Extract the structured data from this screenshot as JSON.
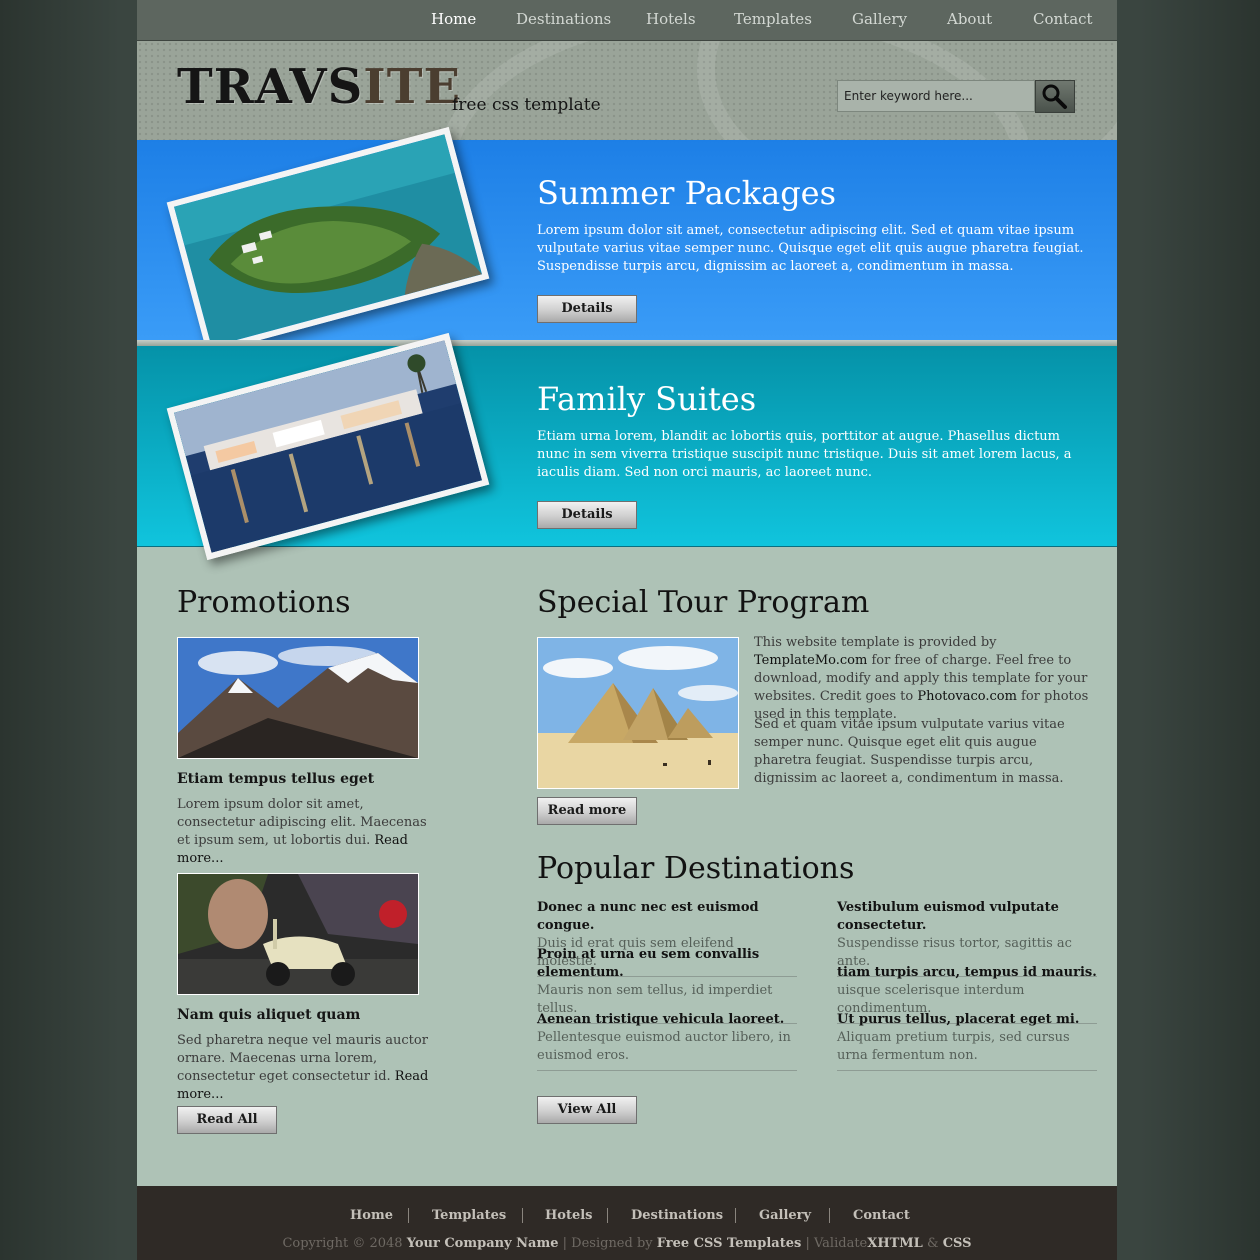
{
  "nav": {
    "items": [
      {
        "label": "Home"
      },
      {
        "label": "Destinations"
      },
      {
        "label": "Hotels"
      },
      {
        "label": "Templates"
      },
      {
        "label": "Gallery"
      },
      {
        "label": "About"
      },
      {
        "label": "Contact"
      }
    ],
    "active": "Home"
  },
  "header": {
    "logo_part1": "TRAVS",
    "logo_part2": "ITE",
    "tagline": "free css template",
    "search_placeholder": "Enter keyword here...",
    "search_icon": "magnifier-icon"
  },
  "banners": [
    {
      "title": "Summer Packages",
      "text": "Lorem ipsum dolor sit amet, consectetur adipiscing elit. Sed et quam vitae ipsum vulputate varius vitae semper nunc. Quisque eget elit quis augue pharetra feugiat. Suspendisse turpis arcu, dignissim ac laoreet a, condimentum in massa.",
      "button": "Details"
    },
    {
      "title": "Family Suites",
      "text": "Etiam urna lorem, blandit ac lobortis quis, porttitor at augue. Phasellus dictum nunc in sem viverra tristique suscipit nunc tristique. Duis sit amet lorem lacus, a iaculis diam. Sed non orci mauris, ac laoreet nunc.",
      "button": "Details"
    }
  ],
  "promotions": {
    "title": "Promotions",
    "items": [
      {
        "title": "Etiam tempus tellus eget",
        "text": "Lorem ipsum dolor sit amet, consectetur adipiscing elit. Maecenas et ipsum sem, ut lobortis dui.",
        "more": "Read more..."
      },
      {
        "title": "Nam quis aliquet quam",
        "text": "Sed pharetra neque vel mauris auctor ornare. Maecenas urna lorem, consectetur eget consectetur id.",
        "more": "Read more..."
      }
    ],
    "button": "Read All"
  },
  "tour": {
    "title": "Special Tour Program",
    "p1_a": "This website template is provided by ",
    "p1_link1": "TemplateMo.com",
    "p1_b": " for free of charge. Feel free to download, modify and apply this template for your websites. Credit goes to ",
    "p1_link2": "Photovaco.com",
    "p1_c": " for photos used in this template.",
    "p2": "Sed et quam vitae ipsum vulputate varius vitae semper nunc. Quisque eget elit quis augue pharetra feugiat. Suspendisse turpis arcu, dignissim ac laoreet a, condimentum in massa.",
    "button": "Read more"
  },
  "destinations": {
    "title": "Popular Destinations",
    "left": [
      {
        "title": "Donec a nunc nec est euismod congue.",
        "text": "Duis id erat quis sem eleifend molestie."
      },
      {
        "title": "Proin at urna eu sem convallis elementum.",
        "text": "Mauris non sem tellus, id imperdiet tellus."
      },
      {
        "title": "Aenean tristique vehicula laoreet.",
        "text": "Pellentesque euismod auctor libero, in euismod eros."
      }
    ],
    "right": [
      {
        "title": "Vestibulum euismod vulputate consectetur.",
        "text": "Suspendisse risus tortor, sagittis ac ante."
      },
      {
        "title": "tiam turpis arcu, tempus id mauris.",
        "text": "uisque scelerisque interdum condimentum."
      },
      {
        "title": "Ut purus tellus, placerat eget mi.",
        "text": "Aliquam pretium turpis, sed cursus urna fermentum non."
      }
    ],
    "button": "View All"
  },
  "footer": {
    "nav": [
      {
        "label": "Home"
      },
      {
        "label": "Templates"
      },
      {
        "label": "Hotels"
      },
      {
        "label": "Destinations"
      },
      {
        "label": "Gallery"
      },
      {
        "label": "Contact"
      }
    ],
    "copyright": "Copyright © 2048",
    "company": "Your Company Name",
    "sep": "|",
    "designed_by": "Designed by",
    "designer": "Free CSS Templates",
    "validate": "Validate",
    "xhtml": "XHTML",
    "amp": "&",
    "css": "CSS"
  },
  "colors": {
    "nav_bg": "#5d665f",
    "summer_banner": "#2a8ef0",
    "family_banner": "#0aa9c2",
    "content_bg": "#aec2b6",
    "footer_bg": "#2f2a26"
  }
}
